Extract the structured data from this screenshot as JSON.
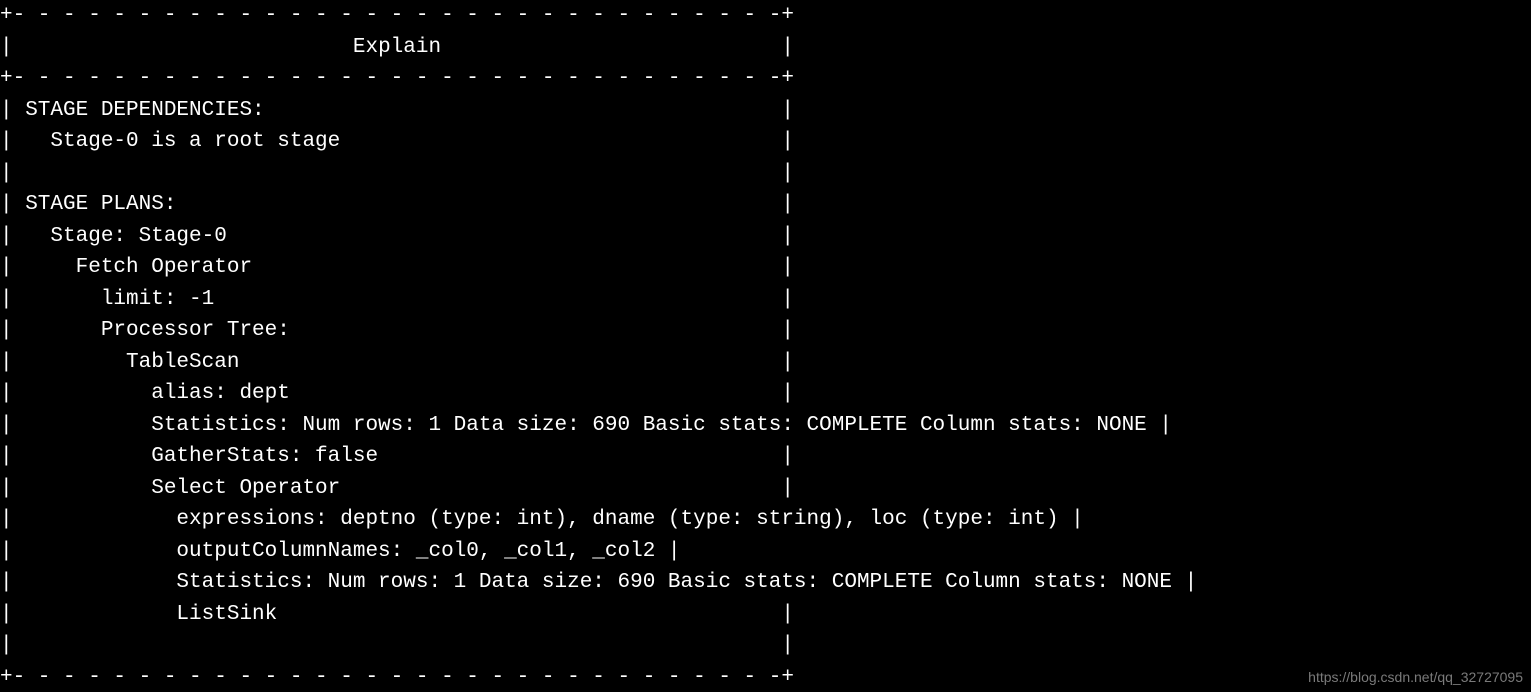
{
  "table": {
    "header_label": "Explain",
    "top_border": "+- - - - - - - - - - - - - - - - - - - - - - - - - - - - - - -+",
    "mid_border": "+- - - - - - - - - - - - - - - - - - - - - - - - - - - - - - -+",
    "bot_border": "+- - - - - - - - - - - - - - - - - - - - - - - - - - - - - - -+",
    "rows": [
      "| STAGE DEPENDENCIES:                                         |",
      "|   Stage-0 is a root stage                                   |",
      "|                                                             |",
      "| STAGE PLANS:                                                |",
      "|   Stage: Stage-0                                            |",
      "|     Fetch Operator                                          |",
      "|       limit: -1                                             |",
      "|       Processor Tree:                                       |",
      "|         TableScan                                           |",
      "|           alias: dept                                       |",
      "|           Statistics: Num rows: 1 Data size: 690 Basic stats: COMPLETE Column stats: NONE |",
      "|           GatherStats: false                                |",
      "|           Select Operator                                   |",
      "|             expressions: deptno (type: int), dname (type: string), loc (type: int) |",
      "|             outputColumnNames: _col0, _col1, _col2 |",
      "|             Statistics: Num rows: 1 Data size: 690 Basic stats: COMPLETE Column stats: NONE |",
      "|             ListSink                                        |",
      "|                                                             |"
    ]
  },
  "watermark": "https://blog.csdn.net/qq_32727095"
}
